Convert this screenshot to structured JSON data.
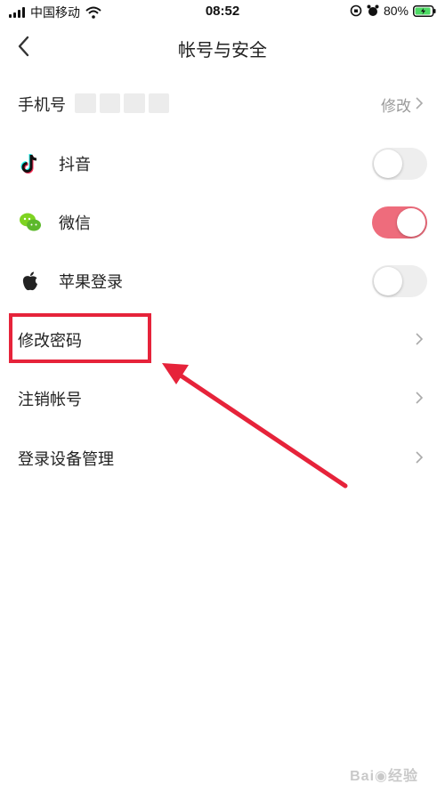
{
  "status_bar": {
    "carrier": "中国移动",
    "time": "08:52",
    "battery": "80%",
    "icons": [
      "signal-icon",
      "wifi-icon",
      "rotation-lock-icon",
      "alarm-icon",
      "battery-icon"
    ]
  },
  "nav": {
    "title": "帐号与安全",
    "back_icon": "back-chevron-icon"
  },
  "rows": {
    "phone": {
      "label": "手机号",
      "action": "修改"
    },
    "douyin": {
      "label": "抖音",
      "icon": "douyin-icon",
      "enabled": false
    },
    "wechat": {
      "label": "微信",
      "icon": "wechat-icon",
      "enabled": true
    },
    "apple": {
      "label": "苹果登录",
      "icon": "apple-icon",
      "enabled": false
    },
    "change_password": {
      "label": "修改密码"
    },
    "cancel_account": {
      "label": "注销帐号"
    },
    "device_management": {
      "label": "登录设备管理"
    }
  },
  "colors": {
    "toggle_on": "#ee6c7c",
    "toggle_off": "#eeeeee",
    "annotation_red": "#e6233a"
  }
}
